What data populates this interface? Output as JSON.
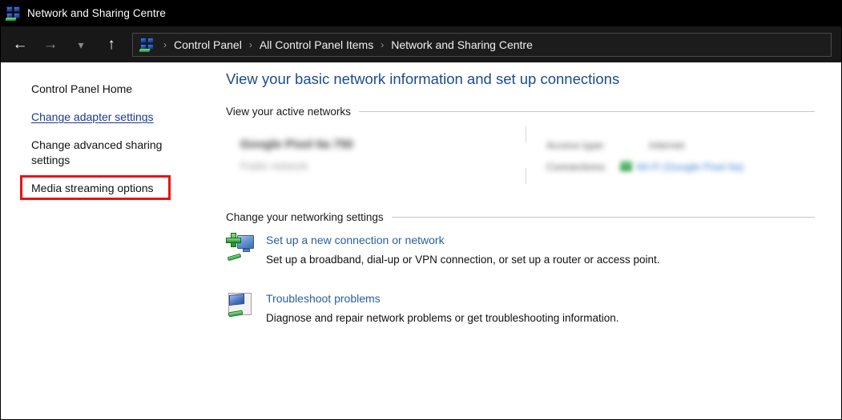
{
  "window": {
    "title": "Network and Sharing Centre",
    "title_icon": "network-sharing-icon"
  },
  "toolbar": {
    "back_icon": "back-arrow-icon",
    "forward_icon": "forward-arrow-icon",
    "recent_icon": "chevron-down-icon",
    "up_icon": "up-arrow-icon",
    "address_icon": "network-sharing-icon",
    "separator": "›",
    "breadcrumbs": [
      "Control Panel",
      "All Control Panel Items",
      "Network and Sharing Centre"
    ]
  },
  "sidebar": {
    "items": [
      {
        "label": "Control Panel Home",
        "is_link": false,
        "highlighted": false
      },
      {
        "label": "Change adapter settings",
        "is_link": true,
        "highlighted": true
      },
      {
        "label": "Change advanced sharing settings",
        "is_link": false,
        "highlighted": false
      },
      {
        "label": "Media streaming options",
        "is_link": false,
        "highlighted": false
      }
    ],
    "highlight_color": "#ee1111",
    "link_color": "#1a3a8f"
  },
  "main": {
    "page_title": "View your basic network information and set up connections",
    "page_title_color": "#1b4b8f",
    "sections": {
      "active_networks": {
        "heading": "View your active networks",
        "redacted": true,
        "redacted_fields": [
          {
            "text": "Google Pixel 6a 750",
            "style": "strong"
          },
          {
            "text": "Public network",
            "style": "faint"
          },
          {
            "text": "Access type:",
            "style": "normal"
          },
          {
            "text": "Internet",
            "style": "normal"
          },
          {
            "text": "Connections:",
            "style": "normal"
          },
          {
            "text": "Wi-Fi (Google Pixel 6a)",
            "style": "link"
          }
        ]
      },
      "networking_settings": {
        "heading": "Change your networking settings",
        "tasks": [
          {
            "icon": "new-connection-icon",
            "link": "Set up a new connection or network",
            "description": "Set up a broadband, dial-up or VPN connection, or set up a router or access point."
          },
          {
            "icon": "troubleshoot-icon",
            "link": "Troubleshoot problems",
            "description": "Diagnose and repair network problems or get troubleshooting information."
          }
        ]
      }
    },
    "link_color": "#2a5f9e"
  }
}
